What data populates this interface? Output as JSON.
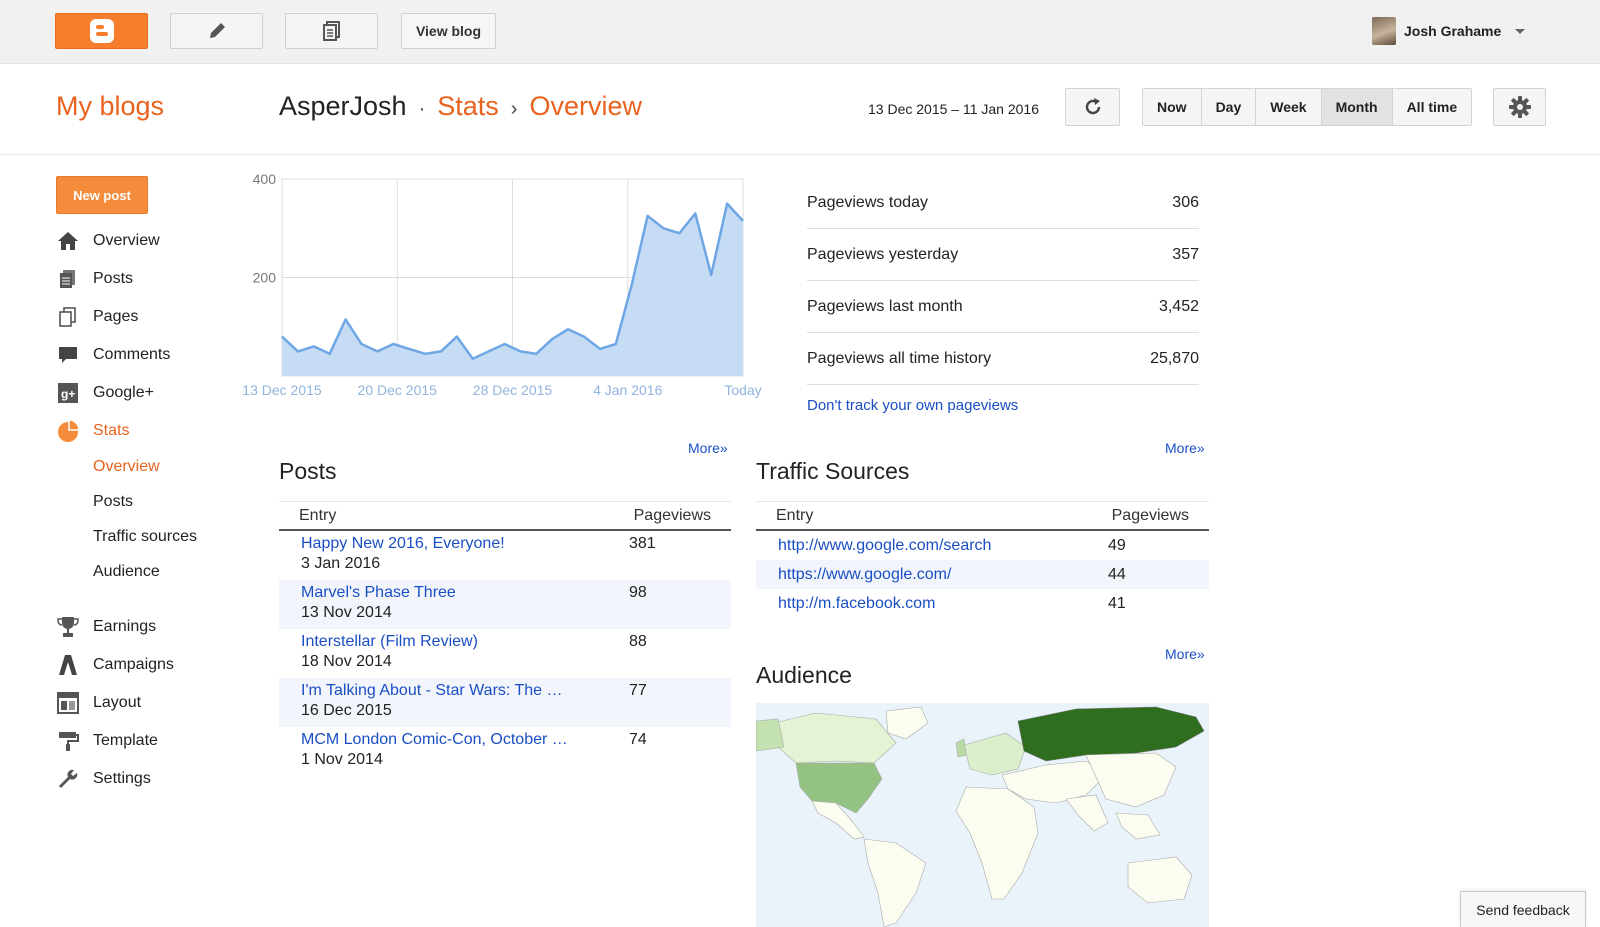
{
  "toolbar": {
    "view_blog_label": "View blog",
    "user_name": "Josh Grahame"
  },
  "header": {
    "my_blogs": "My blogs",
    "blog_name": "AsperJosh",
    "sep1": "·",
    "section": "Stats",
    "sep2": "›",
    "page": "Overview",
    "date_range": "13 Dec 2015 – 11 Jan 2016",
    "ranges": [
      "Now",
      "Day",
      "Week",
      "Month",
      "All time"
    ],
    "active_range": "Month"
  },
  "sidebar": {
    "new_post": "New post",
    "items": [
      {
        "label": "Overview",
        "icon": "home-icon"
      },
      {
        "label": "Posts",
        "icon": "posts-icon"
      },
      {
        "label": "Pages",
        "icon": "pages-icon"
      },
      {
        "label": "Comments",
        "icon": "comment-icon"
      },
      {
        "label": "Google+",
        "icon": "google-plus-icon"
      },
      {
        "label": "Stats",
        "icon": "pie-chart-icon"
      }
    ],
    "sub_items": [
      "Overview",
      "Posts",
      "Traffic sources",
      "Audience"
    ],
    "items2": [
      {
        "label": "Earnings",
        "icon": "trophy-icon"
      },
      {
        "label": "Campaigns",
        "icon": "campaigns-icon"
      },
      {
        "label": "Layout",
        "icon": "layout-icon"
      },
      {
        "label": "Template",
        "icon": "paint-roller-icon"
      },
      {
        "label": "Settings",
        "icon": "wrench-icon"
      }
    ]
  },
  "chart_data": {
    "type": "area",
    "x_tick_labels": [
      "13 Dec 2015",
      "20 Dec 2015",
      "28 Dec 2015",
      "4 Jan 2016",
      "Today"
    ],
    "ylim": [
      0,
      400
    ],
    "y_ticks": [
      200,
      400
    ],
    "values": [
      80,
      50,
      60,
      45,
      115,
      65,
      50,
      65,
      55,
      45,
      50,
      80,
      35,
      50,
      65,
      50,
      45,
      75,
      95,
      80,
      55,
      65,
      185,
      325,
      300,
      290,
      330,
      205,
      350,
      315
    ],
    "grid": true,
    "fill_color": "#c6dcf4",
    "line_color": "#6fa6e6"
  },
  "summary": [
    {
      "label": "Pageviews today",
      "value": "306"
    },
    {
      "label": "Pageviews yesterday",
      "value": "357"
    },
    {
      "label": "Pageviews last month",
      "value": "3,452"
    },
    {
      "label": "Pageviews all time history",
      "value": "25,870"
    }
  ],
  "dont_track": "Don't track your own pageviews",
  "posts": {
    "title": "Posts",
    "more": "More»",
    "col_entry": "Entry",
    "col_pageviews": "Pageviews",
    "rows": [
      {
        "title": "Happy New 2016, Everyone!",
        "date": "3 Jan 2016",
        "pageviews": "381"
      },
      {
        "title": "Marvel's Phase Three",
        "date": "13 Nov 2014",
        "pageviews": "98"
      },
      {
        "title": "Interstellar (Film Review)",
        "date": "18 Nov 2014",
        "pageviews": "88"
      },
      {
        "title": "I'm Talking About - Star Wars: The …",
        "date": "16 Dec 2015",
        "pageviews": "77"
      },
      {
        "title": "MCM London Comic-Con, October …",
        "date": "1 Nov 2014",
        "pageviews": "74"
      }
    ]
  },
  "traffic": {
    "title": "Traffic Sources",
    "more": "More»",
    "col_entry": "Entry",
    "col_pageviews": "Pageviews",
    "rows": [
      {
        "url": "http://www.google.com/search",
        "pageviews": "49"
      },
      {
        "url": "https://www.google.com/",
        "pageviews": "44"
      },
      {
        "url": "http://m.facebook.com",
        "pageviews": "41"
      }
    ]
  },
  "audience": {
    "title": "Audience",
    "more": "More»"
  },
  "feedback": "Send feedback"
}
